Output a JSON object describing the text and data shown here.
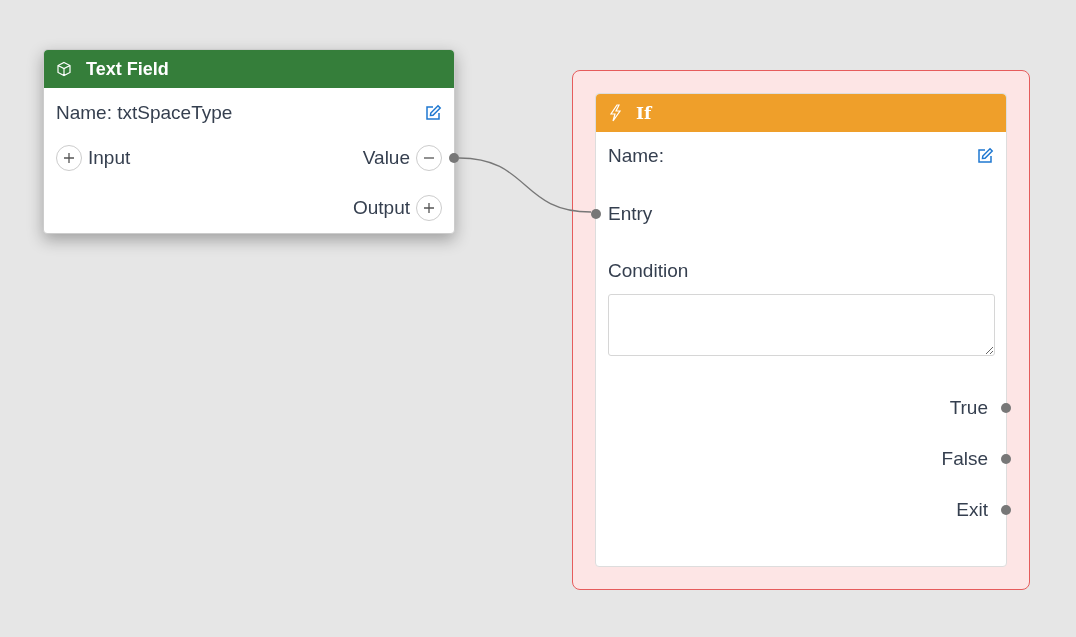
{
  "text_field_node": {
    "title": "Text Field",
    "name": "Name: txtSpaceType",
    "inputs": [
      {
        "label": "Input",
        "connected": false
      }
    ],
    "outputs": [
      {
        "label": "Value",
        "connected": true
      },
      {
        "label": "Output",
        "connected": false
      }
    ]
  },
  "if_node": {
    "title": "If",
    "name": "Name:",
    "selected": true,
    "entry": {
      "label": "Entry",
      "connected": true
    },
    "condition": {
      "label": "Condition"
    },
    "outputs": [
      {
        "label": "True"
      },
      {
        "label": "False"
      },
      {
        "label": "Exit"
      }
    ]
  }
}
